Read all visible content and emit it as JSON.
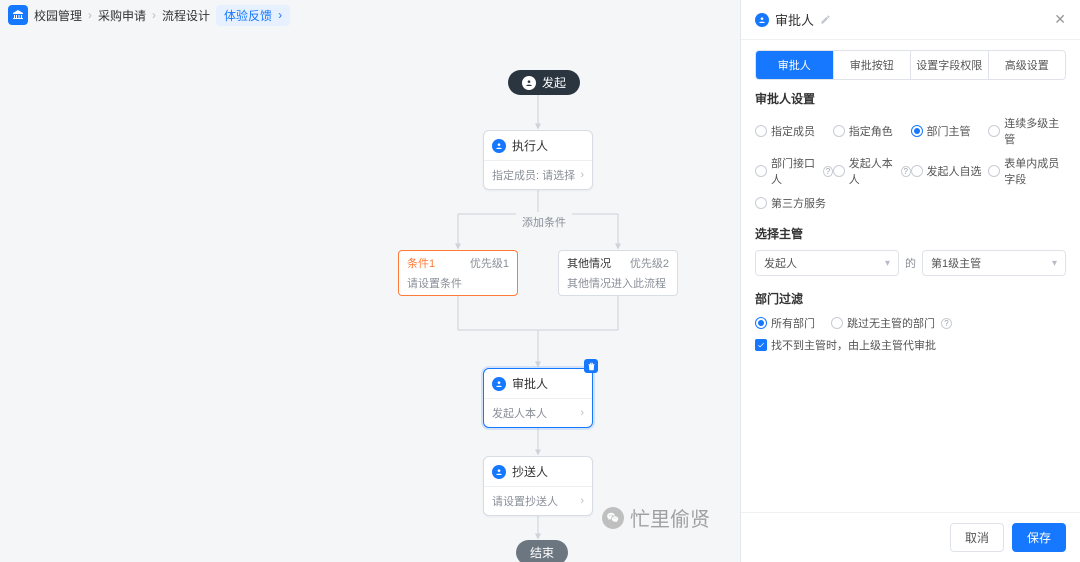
{
  "breadcrumb": {
    "root": "校园管理",
    "items": [
      "采购申请",
      "流程设计"
    ],
    "active": "体验反馈"
  },
  "flow": {
    "start_label": "发起",
    "exec": {
      "title": "执行人",
      "body": "指定成员: 请选择"
    },
    "add_cond_label": "添加条件",
    "cond1": {
      "name": "条件1",
      "priority": "优先级1",
      "desc": "请设置条件"
    },
    "cond2": {
      "name": "其他情况",
      "priority": "优先级2",
      "desc": "其他情况进入此流程"
    },
    "approver": {
      "title": "审批人",
      "body": "发起人本人"
    },
    "cc": {
      "title": "抄送人",
      "body": "请设置抄送人"
    },
    "end_label": "结束"
  },
  "panel": {
    "title": "审批人",
    "tabs": [
      "审批人",
      "审批按钮",
      "设置字段权限",
      "高级设置"
    ],
    "section_approver_title": "审批人设置",
    "approver_options": [
      {
        "label": "指定成员",
        "checked": false
      },
      {
        "label": "指定角色",
        "checked": false
      },
      {
        "label": "部门主管",
        "checked": true
      },
      {
        "label": "连续多级主管",
        "checked": false
      },
      {
        "label": "部门接口人",
        "checked": false,
        "help": true
      },
      {
        "label": "发起人本人",
        "checked": false,
        "help": true
      },
      {
        "label": "发起人自选",
        "checked": false
      },
      {
        "label": "表单内成员字段",
        "checked": false
      },
      {
        "label": "第三方服务",
        "checked": false
      }
    ],
    "section_pick_title": "选择主管",
    "select_from": "发起人",
    "select_of": "的",
    "select_level": "第1级主管",
    "section_filter_title": "部门过滤",
    "filter_options": [
      {
        "label": "所有部门",
        "checked": true
      },
      {
        "label": "跳过无主管的部门",
        "checked": false,
        "help": true
      }
    ],
    "fallback_check": "找不到主管时，由上级主管代审批",
    "btn_cancel": "取消",
    "btn_save": "保存"
  },
  "watermark": "忙里偷贤"
}
